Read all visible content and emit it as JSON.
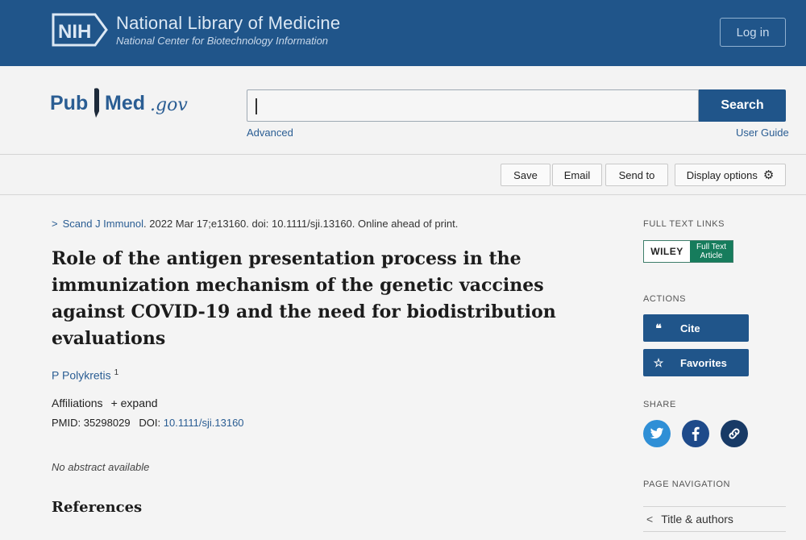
{
  "header": {
    "agency_logo": "NIH",
    "title": "National Library of Medicine",
    "subtitle": "National Center for Biotechnology Information",
    "login_label": "Log in"
  },
  "search": {
    "logo_pub": "Pub",
    "logo_med": "Med",
    "logo_gov": ".gov",
    "value": "",
    "button_label": "Search",
    "advanced_label": "Advanced",
    "guide_label": "User Guide"
  },
  "toolbar": {
    "save_label": "Save",
    "email_label": "Email",
    "send_label": "Send to",
    "display_label": "Display options"
  },
  "article": {
    "journal": "Scand J Immunol",
    "citation_rest": ". 2022 Mar 17;e13160. doi: 10.1111/sji.13160. Online ahead of print.",
    "title": "Role of the antigen presentation process in the immunization mechanism of the genetic vaccines against COVID-19 and the need for biodistribution evaluations",
    "author": "P Polykretis",
    "author_sup": "1",
    "affiliations_label": "Affiliations",
    "expand_label": "+ expand",
    "pmid_label": "PMID: 35298029",
    "doi_label": "DOI:",
    "doi_value": "10.1111/sji.13160",
    "no_abstract": "No abstract available",
    "references_heading": "References"
  },
  "sidebar": {
    "full_text_heading": "FULL TEXT LINKS",
    "wiley_brand": "WILEY",
    "wiley_line1": "Full Text",
    "wiley_line2": "Article",
    "actions_heading": "ACTIONS",
    "cite_label": "Cite",
    "favorites_label": "Favorites",
    "share_heading": "SHARE",
    "page_nav_heading": "PAGE NAVIGATION",
    "nav_item": "Title & authors"
  },
  "colors": {
    "brand_blue": "#20558a",
    "link_blue": "#2a5d93",
    "twitter": "#2f8fd6",
    "facebook": "#1e4a8a",
    "link_share": "#183a66",
    "wiley_green": "#167c5c"
  }
}
